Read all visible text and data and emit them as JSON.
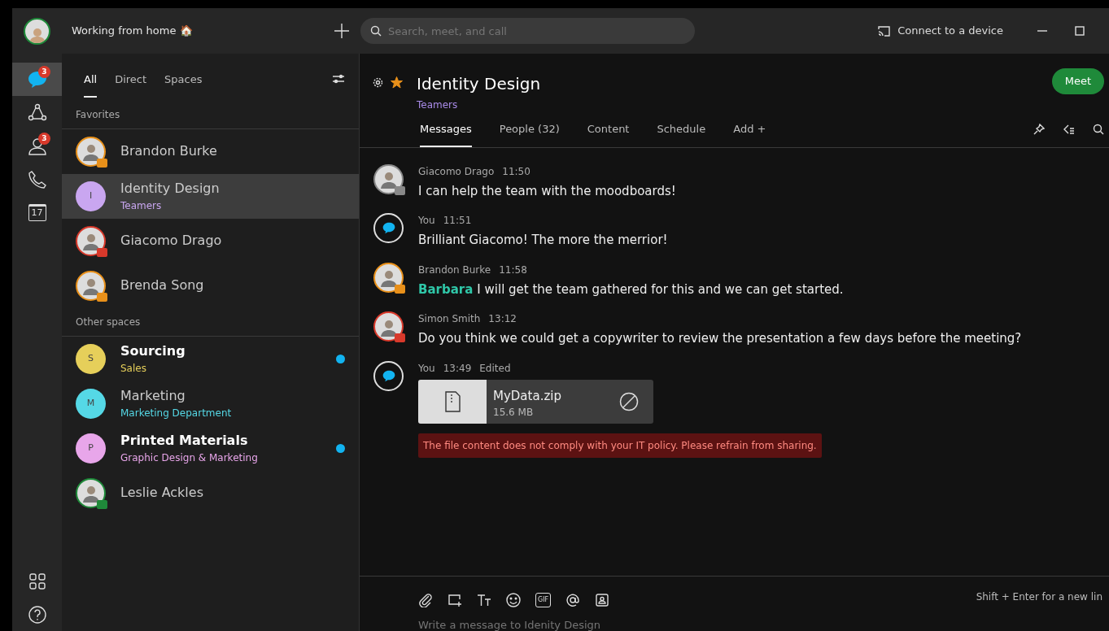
{
  "status": {
    "text": "Working from home 🏠"
  },
  "search": {
    "placeholder": "Search, meet, and call"
  },
  "connect": {
    "label": "Connect to a device"
  },
  "rail": [
    {
      "kind": "chat",
      "badge": "3",
      "selected": true
    },
    {
      "kind": "teams",
      "selected": false
    },
    {
      "kind": "contacts",
      "badge": "3",
      "selected": false
    },
    {
      "kind": "calls",
      "selected": false
    },
    {
      "kind": "calendar",
      "label": "17",
      "selected": false
    }
  ],
  "list_tabs": [
    {
      "label": "All",
      "selected": true
    },
    {
      "label": "Direct",
      "selected": false
    },
    {
      "label": "Spaces",
      "selected": false
    }
  ],
  "sections": [
    {
      "title": "Favorites",
      "items": [
        {
          "kind": "person",
          "name": "Brandon Burke",
          "color": "#e8901a",
          "selected": false,
          "unread": false
        },
        {
          "kind": "space",
          "name": "Identity Design",
          "initial": "I",
          "subtitle": "Teamers",
          "color": "#c9a6f0",
          "selected": true,
          "unread": false
        },
        {
          "kind": "person",
          "name": "Giacomo Drago",
          "color": "#d8392b",
          "selected": false,
          "unread": false
        },
        {
          "kind": "person",
          "name": "Brenda Song",
          "color": "#e8901a",
          "selected": false,
          "unread": false
        }
      ]
    },
    {
      "title": "Other spaces",
      "items": [
        {
          "kind": "space",
          "name": "Sourcing",
          "initial": "S",
          "subtitle": "Sales",
          "color": "#e6cf5a",
          "selected": false,
          "unread": true
        },
        {
          "kind": "space",
          "name": "Marketing",
          "initial": "M",
          "subtitle": "Marketing Department",
          "color": "#55d8e6",
          "selected": false,
          "unread": false
        },
        {
          "kind": "space",
          "name": "Printed Materials",
          "initial": "P",
          "subtitle": "Graphic Design & Marketing",
          "color": "#e8a6ea",
          "selected": false,
          "unread": true
        },
        {
          "kind": "person",
          "name": "Leslie Ackles",
          "color": "#1f8a3a",
          "selected": false,
          "unread": false
        }
      ]
    }
  ],
  "space": {
    "title": "Identity Design",
    "subtitle": "Teamers",
    "favorite": true,
    "meet": "Meet"
  },
  "space_tabs": [
    {
      "label": "Messages",
      "selected": true
    },
    {
      "label": "People (32)",
      "selected": false
    },
    {
      "label": "Content",
      "selected": false
    },
    {
      "label": "Schedule",
      "selected": false
    },
    {
      "label": "Add +",
      "selected": false
    }
  ],
  "messages": [
    {
      "kind": "person",
      "author": "Giacomo Drago",
      "time": "11:50",
      "color": "#888888",
      "text": "I can help the team with the moodboards!"
    },
    {
      "kind": "self",
      "author": "You",
      "time": "11:51",
      "text": "Brilliant Giacomo! The more the merrior!"
    },
    {
      "kind": "person",
      "author": "Brandon Burke",
      "time": "11:58",
      "color": "#e8901a",
      "mention": "Barbara",
      "text": "I will get the team gathered for this and we can get started."
    },
    {
      "kind": "person",
      "author": "Simon Smith",
      "time": "13:12",
      "color": "#d8392b",
      "text": "Do you think we could get a copywriter to review the presentation a few days before the meeting?"
    },
    {
      "kind": "self",
      "author": "You",
      "time": "13:49",
      "edited": "Edited",
      "file": {
        "name": "MyData.zip",
        "size": "15.6 MB"
      },
      "warning": "The file content does not comply with your IT policy. Please refrain from sharing."
    }
  ],
  "composer": {
    "gif": "GIF",
    "hint": "Shift + Enter for a new lin",
    "placeholder": "Write a message to Idenity Design"
  },
  "sidebar_bottom": [
    {
      "kind": "apps"
    },
    {
      "kind": "help"
    }
  ]
}
